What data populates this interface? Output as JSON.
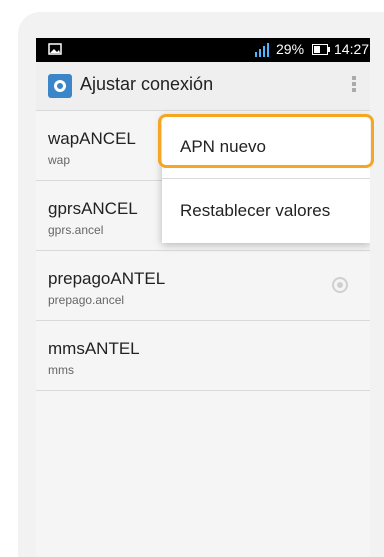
{
  "status_bar": {
    "battery_percent": "29%",
    "time": "14:27",
    "icons": [
      "image-icon",
      "signal-icon",
      "battery-icon"
    ]
  },
  "action_bar": {
    "title": "Ajustar conexión",
    "icon": "settings-gear-icon"
  },
  "apn_list": [
    {
      "name": "wapANCEL",
      "sub": "wap"
    },
    {
      "name": "gprsANCEL",
      "sub": "gprs.ancel"
    },
    {
      "name": "prepagoANTEL",
      "sub": "prepago.ancel"
    },
    {
      "name": "mmsANTEL",
      "sub": "mms"
    }
  ],
  "menu": {
    "items": [
      {
        "label": "APN nuevo"
      },
      {
        "label": "Restablecer valores"
      }
    ]
  },
  "colors": {
    "highlight": "#f5a623",
    "app_icon": "#3a86c8"
  }
}
